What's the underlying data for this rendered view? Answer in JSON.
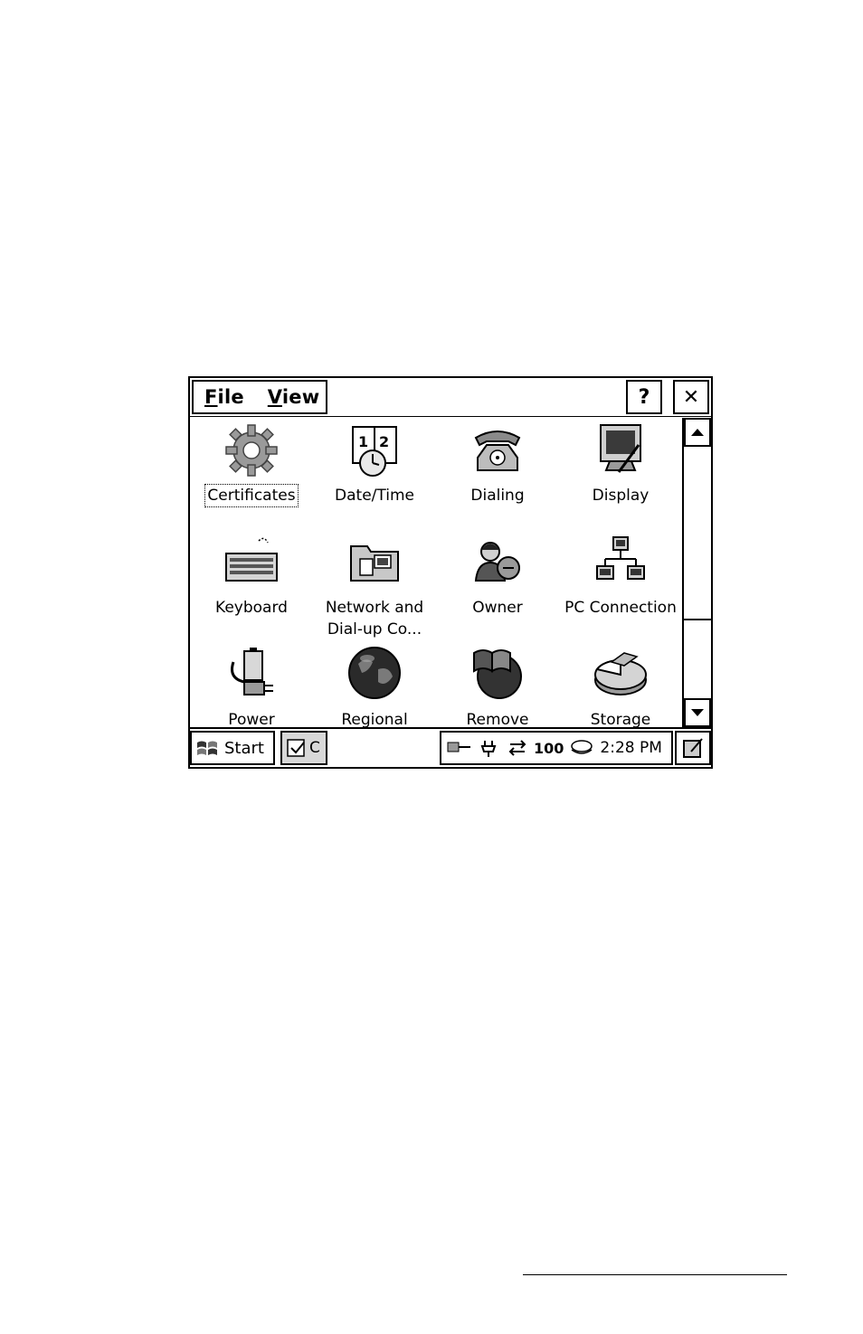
{
  "menubar": {
    "file_label": "File",
    "file_key": "F",
    "file_rest": "ile",
    "view_label": "View",
    "view_key": "V",
    "view_rest": "iew"
  },
  "titlebar": {
    "help_label": "?",
    "close_label": "✕"
  },
  "items": [
    {
      "label": "Certificates",
      "icon": "gear-icon"
    },
    {
      "label": "Date/Time",
      "icon": "calendar-clock-icon"
    },
    {
      "label": "Dialing",
      "icon": "telephone-icon"
    },
    {
      "label": "Display",
      "icon": "monitor-icon"
    },
    {
      "label": "Keyboard",
      "icon": "keyboard-icon"
    },
    {
      "label": "Network and\nDial-up Co...",
      "icon": "network-folder-icon"
    },
    {
      "label": "Owner",
      "icon": "owner-people-icon"
    },
    {
      "label": "PC Connection",
      "icon": "pc-connection-icon"
    },
    {
      "label": "Power",
      "icon": "power-battery-icon"
    },
    {
      "label": "Regional",
      "icon": "globe-icon"
    },
    {
      "label": "Remove",
      "icon": "remove-programs-icon"
    },
    {
      "label": "Storage",
      "icon": "storage-pie-icon"
    }
  ],
  "taskbar": {
    "start_label": "Start",
    "task_label": "C",
    "clock": "2:28 PM",
    "tray_badge": "100"
  },
  "colors": {
    "ink": "#000000",
    "paper": "#ffffff",
    "task_bg": "#d8d8d8"
  }
}
